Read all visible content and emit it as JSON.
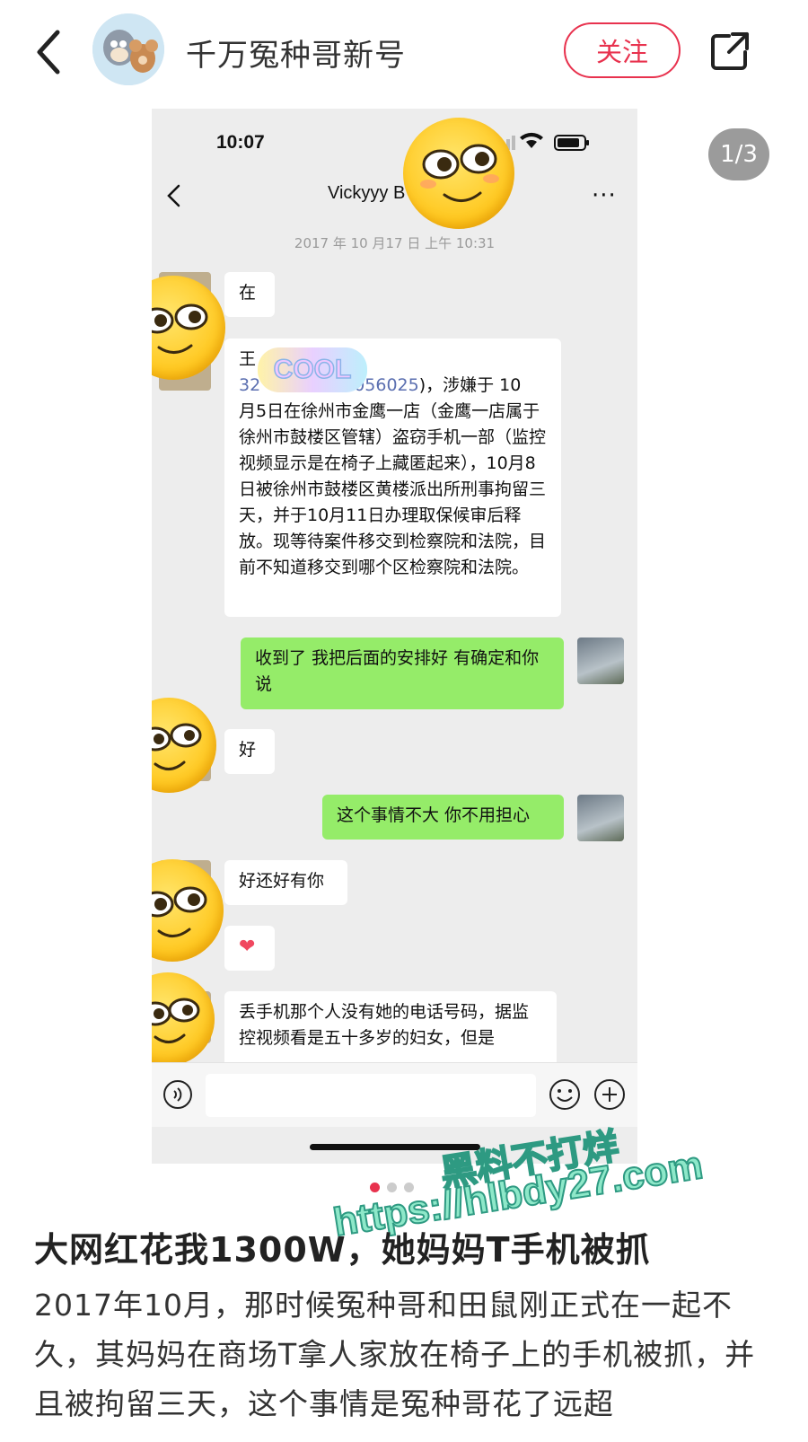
{
  "header": {
    "username": "千万冤种哥新号",
    "follow_label": "关注"
  },
  "post_image": {
    "counter": "1/3",
    "status_time": "10:07",
    "chat_title": "Vickyyy",
    "chat_title_suffix": "B",
    "more": "···",
    "date": "2017 年 10 月17 日 上午 10:31",
    "sticker_text": "COOL",
    "messages": [
      {
        "side": "left",
        "text": "在"
      },
      {
        "side": "left",
        "line1_prefix": "王",
        "link_a": "32",
        "link_b": "056025",
        "after_link": ")，涉嫌于 10",
        "text": "月5日在徐州市金鹰一店（金鹰一店属于徐州市鼓楼区管辖）盗窃手机一部（监控视频显示是在椅子上藏匿起来），10月8日被徐州市鼓楼区黄楼派出所刑事拘留三天，并于10月11日办理取保候审后释放。现等待案件移交到检察院和法院，目前不知道移交到哪个区检察院和法院。"
      },
      {
        "side": "right",
        "text": "收到了 我把后面的安排好 有确定和你说"
      },
      {
        "side": "left",
        "text": "好"
      },
      {
        "side": "right",
        "text": "这个事情不大 你不用担心"
      },
      {
        "side": "left",
        "text": "好还好有你"
      },
      {
        "side": "left",
        "text": "❤"
      },
      {
        "side": "left",
        "text": "丢手机那个人没有她的电话号码，据监控视频看是五十多岁的妇女，但是"
      }
    ]
  },
  "watermark": {
    "line1": "黑料不打烊",
    "line2": "https://hlbdy27.com"
  },
  "post": {
    "title": "大网红花我1300W，她妈妈T手机被抓",
    "body": "2017年10月，那时候冤种哥和田鼠刚正式在一起不久，其妈妈在商场T拿人家放在椅子上的手机被抓，并且被拘留三天，这个事情是冤种哥花了远超"
  },
  "colors": {
    "accent": "#e8324e",
    "wechat_green": "#95ec69",
    "chat_bg": "#ededed"
  },
  "icons": [
    "back-arrow-icon",
    "share-icon",
    "wifi-icon",
    "battery-icon",
    "voice-icon",
    "emoji-icon",
    "plus-icon",
    "heart-icon"
  ]
}
